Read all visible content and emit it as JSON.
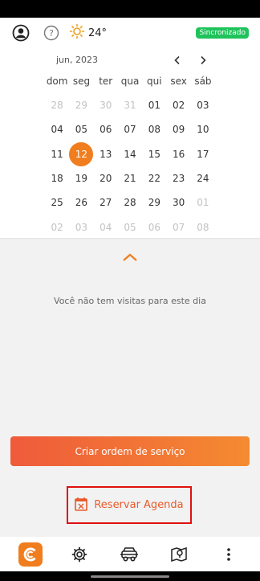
{
  "header": {
    "temperature": "24°",
    "sync_status": "Sincronizado",
    "icons": [
      "user-circle-icon",
      "help-icon",
      "sun-icon"
    ],
    "sync_color": "#1fc35b"
  },
  "calendar": {
    "month_label": "jun, 2023",
    "weekdays": [
      "dom",
      "seg",
      "ter",
      "qua",
      "qui",
      "sex",
      "sáb"
    ],
    "weeks": [
      [
        "28",
        "29",
        "30",
        "31",
        "01",
        "02",
        "03"
      ],
      [
        "04",
        "05",
        "06",
        "07",
        "08",
        "09",
        "10"
      ],
      [
        "11",
        "12",
        "13",
        "14",
        "15",
        "16",
        "17"
      ],
      [
        "18",
        "19",
        "20",
        "21",
        "22",
        "23",
        "24"
      ],
      [
        "25",
        "26",
        "27",
        "28",
        "29",
        "30",
        "01"
      ],
      [
        "02",
        "03",
        "04",
        "05",
        "06",
        "07",
        "08"
      ]
    ],
    "selected_day": "12",
    "accent": "#f07d1e"
  },
  "main": {
    "empty_message": "Você não tem visitas para este dia",
    "create_order_label": "Criar ordem de serviço",
    "reserve_label": "Reservar Agenda"
  },
  "bottom_nav": {
    "items": [
      "app-logo",
      "settings-gear-icon",
      "vehicle-icon",
      "map-pin-icon",
      "more-vertical-icon"
    ]
  }
}
